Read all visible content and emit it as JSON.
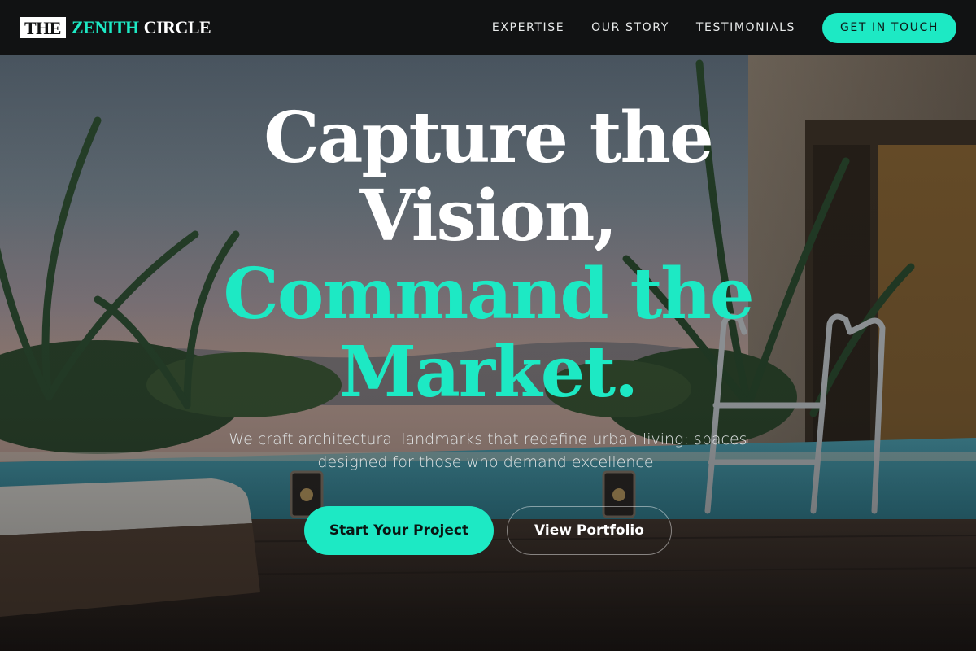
{
  "brand": {
    "logo_box": "THE",
    "logo_accent": "ZENITH",
    "logo_rest": "CIRCLE",
    "accent_color": "#1de9c4"
  },
  "nav": {
    "links": [
      "EXPERTISE",
      "OUR STORY",
      "TESTIMONIALS"
    ],
    "cta": "GET IN TOUCH"
  },
  "hero": {
    "line1": "Capture the",
    "line2": "Vision,",
    "line3": "Command the",
    "line4": "Market.",
    "subtext": "We craft architectural landmarks that redefine urban living: spaces designed for those who demand excellence.",
    "primary_button": "Start Your Project",
    "secondary_button": "View Portfolio"
  }
}
